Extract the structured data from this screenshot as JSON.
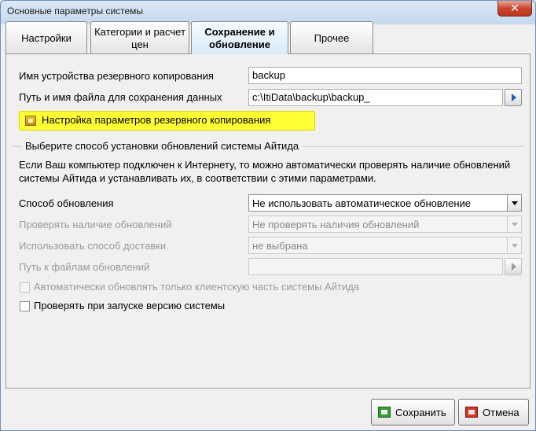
{
  "window": {
    "title": "Основные параметры системы",
    "close_label": "✕"
  },
  "tabs": [
    {
      "label": "Настройки"
    },
    {
      "label": "Категории и расчет цен"
    },
    {
      "label": "Сохранение и обновление",
      "active": true
    },
    {
      "label": "Прочее"
    }
  ],
  "backup": {
    "device_label": "Имя устройства резервного копирования",
    "device_value": "backup",
    "path_label": "Путь и имя файла для сохранения данных",
    "path_value": "c:\\ItiData\\backup\\backup_",
    "settings_button": "Настройка параметров резервного копирования"
  },
  "updates": {
    "group_title": "Выберите способ установки обновлений системы Айтида",
    "description": "Если Ваш компьютер подключен к Интернету, то можно автоматически проверять наличие обновлений системы Айтида и устанавливать их, в соответствии с этими параметрами.",
    "method_label": "Способ обновления",
    "method_value": "Не использовать автоматическое обновление",
    "check_label": "Проверять наличие обновлений",
    "check_value": "Не проверять наличия обновлений",
    "delivery_label": "Использовать способ доставки",
    "delivery_value": "не выбрана",
    "path_label": "Путь к файлам обновлений",
    "path_value": "",
    "client_only_label": "Автоматически обновлять только клиентскую часть системы Айтида",
    "client_only_checked": false,
    "check_on_start_label": "Проверять при запуске  версию системы",
    "check_on_start_checked": false
  },
  "footer": {
    "save_label": "Сохранить",
    "cancel_label": "Отмена"
  },
  "colors": {
    "highlight": "#ffff33",
    "browse_arrow": "#1d5fc2"
  }
}
